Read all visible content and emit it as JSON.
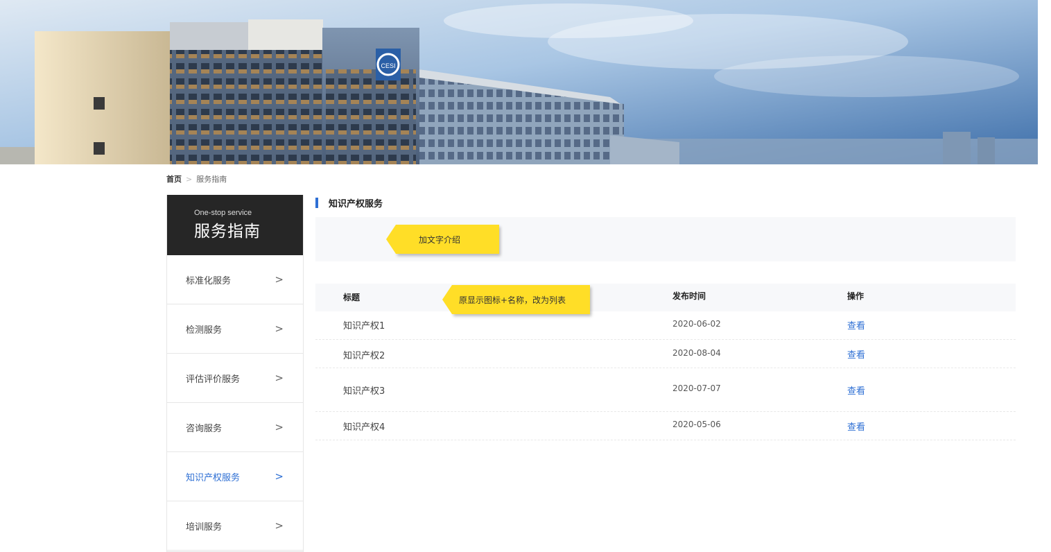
{
  "breadcrumb": {
    "home": "首页",
    "separator": ">",
    "current": "服务指南"
  },
  "sidebar": {
    "subtitle_en": "One-stop service",
    "title_cn": "服务指南",
    "items": [
      {
        "label": "标准化服务",
        "active": false
      },
      {
        "label": "检测服务",
        "active": false
      },
      {
        "label": "评估评价服务",
        "active": false
      },
      {
        "label": "咨询服务",
        "active": false
      },
      {
        "label": "知识产权服务",
        "active": true
      },
      {
        "label": "培训服务",
        "active": false
      }
    ],
    "chevron": ">"
  },
  "section": {
    "title": "知识产权服务"
  },
  "annotations": {
    "intro_note": "加文字介绍",
    "list_note": "原显示图标+名称，改为列表"
  },
  "table": {
    "headers": {
      "title": "标题",
      "date": "发布时间",
      "action": "操作"
    },
    "rows": [
      {
        "title": "知识产权1",
        "date": "2020-06-02",
        "action": "查看"
      },
      {
        "title": "知识产权2",
        "date": "2020-08-04",
        "action": "查看"
      },
      {
        "title": "知识产权3",
        "date": "2020-07-07",
        "action": "查看"
      },
      {
        "title": "知识产权4",
        "date": "2020-05-06",
        "action": "查看"
      }
    ]
  },
  "banner": {
    "logo_text": "CESI"
  },
  "colors": {
    "accent": "#2e6fd4",
    "sidebar_header": "#262626",
    "callout": "#ffde27",
    "panel_bg": "#f7f8fa"
  }
}
